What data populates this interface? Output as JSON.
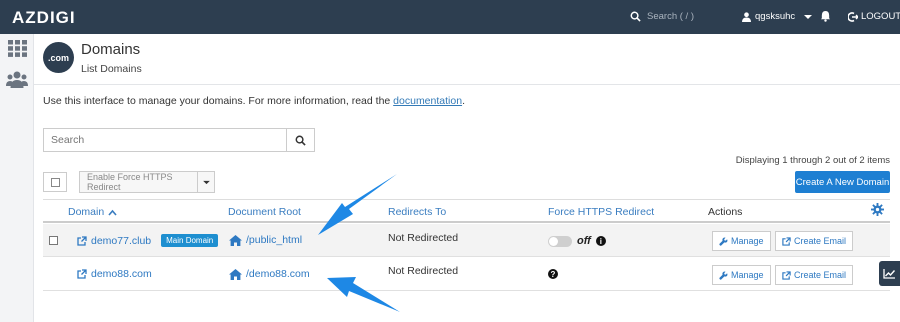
{
  "topbar": {
    "brand": "AZDIGI",
    "search_placeholder": "Search ( / )",
    "username": "qgsksuhc",
    "logout_label": "LOGOUT"
  },
  "header": {
    "icon_text": ".com",
    "title": "Domains",
    "subtitle": "List Domains"
  },
  "intro": {
    "text": "Use this interface to manage your domains. For more information, read the",
    "link": "documentation",
    "end": "."
  },
  "search": {
    "placeholder": "Search"
  },
  "pagination": {
    "text": "Displaying 1 through 2 out of 2 items"
  },
  "toolbar": {
    "https_label": "Enable Force HTTPS Redirect",
    "create_label": "Create A New Domain"
  },
  "table": {
    "headers": {
      "domain": "Domain",
      "docroot": "Document Root",
      "redirects": "Redirects To",
      "https": "Force HTTPS Redirect",
      "actions": "Actions"
    },
    "rows": [
      {
        "domain": "demo77.club",
        "badge": "Main Domain",
        "docroot": "/public_html",
        "redirects": "Not Redirected",
        "https_state": "off",
        "manage": "Manage",
        "email": "Create Email"
      },
      {
        "domain": "demo88.com",
        "badge": "",
        "docroot": "/demo88.com",
        "redirects": "Not Redirected",
        "https_state": "",
        "manage": "Manage",
        "email": "Create Email"
      }
    ]
  },
  "colors": {
    "topbar": "#2d3e50",
    "link": "#2e79c2",
    "primary_button": "#1e7fd2",
    "arrow": "#1e88e5"
  }
}
